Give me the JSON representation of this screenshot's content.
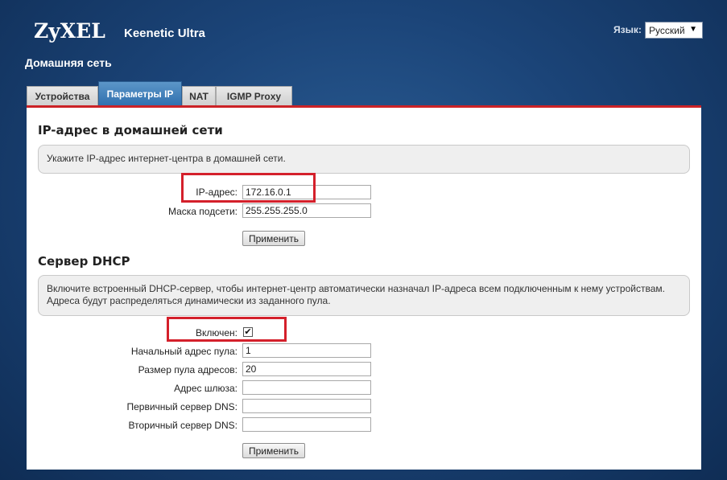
{
  "header": {
    "logo": "ZyXEL",
    "model": "Keenetic Ultra",
    "lang_label": "Язык:",
    "lang_value": "Русский",
    "lang_arrow_icon": "chevron-down-icon"
  },
  "page_title": "Домашняя сеть",
  "tabs": [
    {
      "label": "Устройства",
      "active": false
    },
    {
      "label": "Параметры IP",
      "active": true
    },
    {
      "label": "NAT",
      "active": false
    },
    {
      "label": "IGMP Proxy",
      "active": false
    }
  ],
  "ip_section": {
    "title": "IP-адрес в домашней сети",
    "note": "Укажите IP-адрес интернет-центра в домашней сети.",
    "ip_label": "IP-адрес:",
    "ip_value": "172.16.0.1",
    "mask_label": "Маска подсети:",
    "mask_value": "255.255.255.0",
    "apply_label": "Применить"
  },
  "dhcp_section": {
    "title": "Сервер DHCP",
    "note": "Включите встроенный DHCP-сервер, чтобы интернет-центр автоматически назначал IP-адреса всем подключенным к нему устройствам. Адреса будут распределяться динамически из заданного пула.",
    "enabled_label": "Включен:",
    "enabled": true,
    "pool_start_label": "Начальный адрес пула:",
    "pool_start_value": "1",
    "pool_size_label": "Размер пула адресов:",
    "pool_size_value": "20",
    "gateway_label": "Адрес шлюза:",
    "gateway_value": "",
    "dns1_label": "Первичный сервер DNS:",
    "dns1_value": "",
    "dns2_label": "Вторичный сервер DNS:",
    "dns2_value": "",
    "apply_label": "Применить"
  },
  "colors": {
    "highlight": "#d4202b",
    "panel_border": "#cc2226",
    "active_tab": "#2f6fae",
    "background": "#1b4478"
  }
}
